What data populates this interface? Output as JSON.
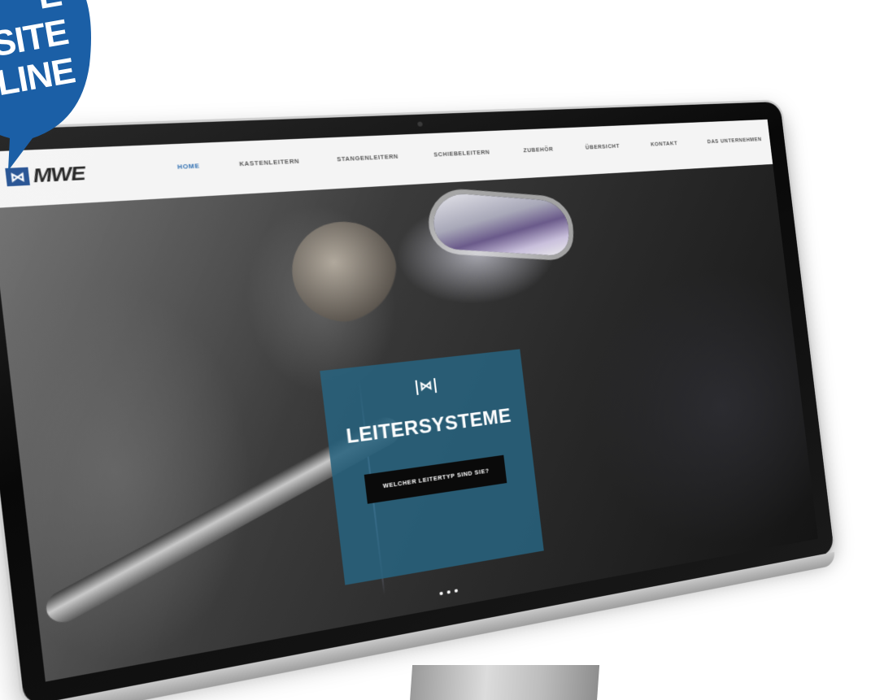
{
  "badge": {
    "lines": [
      "E",
      "SITE",
      "LINE"
    ],
    "color": "#1b5fa6"
  },
  "site": {
    "logo_text": "MWE",
    "logo_icon": "ladder-logo-icon",
    "nav": [
      {
        "label": "HOME",
        "active": true
      },
      {
        "label": "KASTENLEITERN"
      },
      {
        "label": "STANGENLEITERN"
      },
      {
        "label": "SCHIEBELEITERN"
      },
      {
        "label": "ZUBEHÖR"
      },
      {
        "label": "ÜBERSICHT"
      },
      {
        "label": "KONTAKT"
      },
      {
        "label": "DAS UNTERNEHMEN"
      }
    ],
    "hero": {
      "icon": "ladder-logo-icon",
      "title": "LEITERSYSTEME",
      "button_label": "WELCHER LEITERTYP SIND SIE?",
      "box_color": "#28627d"
    },
    "slider_dots": 3
  }
}
